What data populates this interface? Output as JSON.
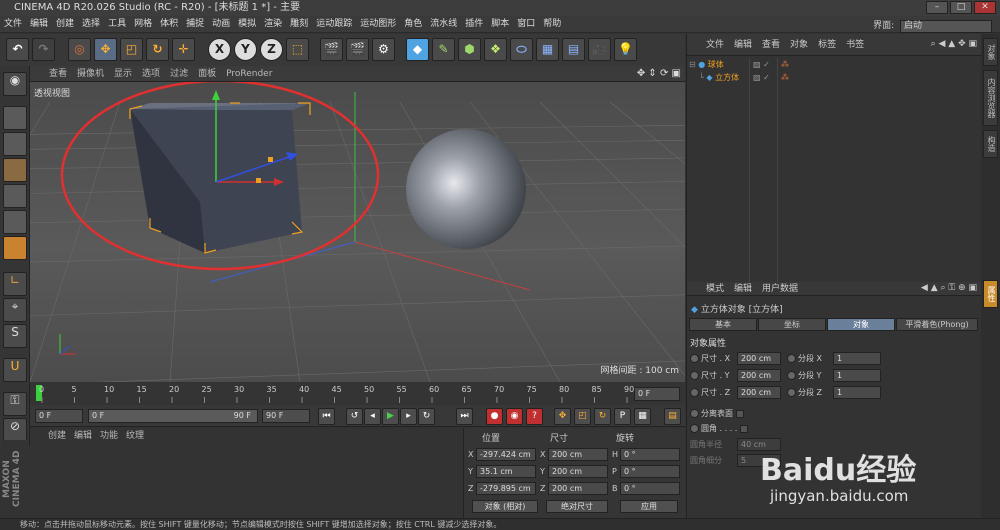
{
  "window": {
    "title": "CINEMA 4D R20.026 Studio (RC - R20) - [未标题 1 *] - 主要"
  },
  "menu": [
    "文件",
    "编辑",
    "创建",
    "选择",
    "工具",
    "网格",
    "体积",
    "捕捉",
    "动画",
    "模拟",
    "渲染",
    "雕刻",
    "运动跟踪",
    "运动图形",
    "角色",
    "流水线",
    "插件",
    "脚本",
    "窗口",
    "帮助"
  ],
  "layout": {
    "label": "界面:",
    "value": "启动"
  },
  "toolbar": {
    "x_label": "X",
    "y_label": "Y",
    "z_label": "Z"
  },
  "viewport": {
    "menu": [
      "查看",
      "摄像机",
      "显示",
      "选项",
      "过滤",
      "面板",
      "ProRender"
    ],
    "label": "透视视图",
    "grid_info": "网格间距 : 100 cm",
    "annotation_color": "#e03030"
  },
  "timeline": {
    "ticks": [
      "0",
      "5",
      "10",
      "15",
      "20",
      "25",
      "30",
      "35",
      "40",
      "45",
      "50",
      "55",
      "60",
      "65",
      "70",
      "75",
      "80",
      "85",
      "90"
    ],
    "current_frame": "0 F",
    "start": "0 F",
    "range_left": "0 F",
    "range_right": "90 F",
    "end": "90 F"
  },
  "material_manager": {
    "menu": [
      "创建",
      "编辑",
      "功能",
      "纹理"
    ]
  },
  "coordinates": {
    "headers": {
      "position": "位置",
      "size": "尺寸",
      "rotation": "旋转"
    },
    "rows": [
      {
        "axis": "X",
        "pos": "-297.424 cm",
        "size_axis": "X",
        "size": "200 cm",
        "rot_axis": "H",
        "rot": "0 °"
      },
      {
        "axis": "Y",
        "pos": "35.1 cm",
        "size_axis": "Y",
        "size": "200 cm",
        "rot_axis": "P",
        "rot": "0 °"
      },
      {
        "axis": "Z",
        "pos": "-279.895 cm",
        "size_axis": "Z",
        "size": "200 cm",
        "rot_axis": "B",
        "rot": "0 °"
      }
    ],
    "mode_select": "对象 (相对)",
    "size_select": "绝对尺寸",
    "apply_button": "应用"
  },
  "object_manager": {
    "menu": [
      "文件",
      "编辑",
      "查看",
      "对象",
      "标签",
      "书签"
    ],
    "objects": [
      {
        "name": "球体"
      },
      {
        "name": "立方体"
      }
    ]
  },
  "attribute_manager": {
    "menu": [
      "模式",
      "编辑",
      "用户数据"
    ],
    "object_title": "立方体对象 [立方体]",
    "tabs": [
      "基本",
      "坐标",
      "对象",
      "平滑着色(Phong)"
    ],
    "section": "对象属性",
    "size_rows": [
      {
        "label": "尺寸 . X",
        "value": "200 cm",
        "seg_label": "分段 X",
        "seg": "1"
      },
      {
        "label": "尺寸 . Y",
        "value": "200 cm",
        "seg_label": "分段 Y",
        "seg": "1"
      },
      {
        "label": "尺寸 . Z",
        "value": "200 cm",
        "seg_label": "分段 Z",
        "seg": "1"
      }
    ],
    "separate_surfaces": "分离表面",
    "fillet": "圆角 . . . .",
    "fillet_radius_label": "圆角半径",
    "fillet_radius": "40 cm",
    "fillet_subdiv_label": "圆角细分",
    "fillet_subdiv": "5"
  },
  "right_strip": [
    "对象",
    "内容浏览器",
    "构造"
  ],
  "right_strip_attr": "属性",
  "brand": "MAXON CINEMA 4D",
  "status": "移动：点击并拖动鼠标移动元素。按住 SHIFT 键量化移动；节点编辑模式时按住 SHIFT 键增加选择对象；按住 CTRL 键减少选择对象。",
  "watermark": {
    "main": "Baidu经验",
    "sub": "jingyan.baidu.com"
  }
}
